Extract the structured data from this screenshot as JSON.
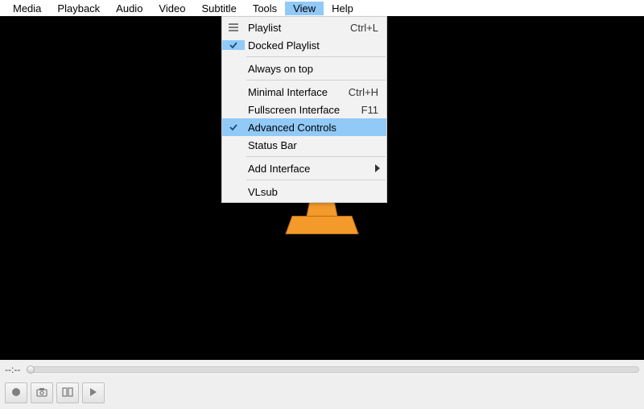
{
  "menubar": {
    "items": [
      "Media",
      "Playback",
      "Audio",
      "Video",
      "Subtitle",
      "Tools",
      "View",
      "Help"
    ],
    "open_index": 6
  },
  "view_menu": {
    "playlist": {
      "label": "Playlist",
      "shortcut": "Ctrl+L"
    },
    "docked_playlist": {
      "label": "Docked Playlist",
      "shortcut": ""
    },
    "always_on_top": {
      "label": "Always on top",
      "shortcut": ""
    },
    "minimal_interface": {
      "label": "Minimal Interface",
      "shortcut": "Ctrl+H"
    },
    "fullscreen_interface": {
      "label": "Fullscreen Interface",
      "shortcut": "F11"
    },
    "advanced_controls": {
      "label": "Advanced Controls",
      "shortcut": ""
    },
    "status_bar": {
      "label": "Status Bar",
      "shortcut": ""
    },
    "add_interface": {
      "label": "Add Interface",
      "shortcut": ""
    },
    "vlsub": {
      "label": "VLsub",
      "shortcut": ""
    }
  },
  "status": {
    "time": "--:--"
  },
  "icons": {
    "playlist": "playlist-icon",
    "check": "check-icon",
    "record": "record-icon",
    "snapshot": "snapshot-icon",
    "loop": "loop-icon",
    "frame": "frame-step-icon"
  }
}
